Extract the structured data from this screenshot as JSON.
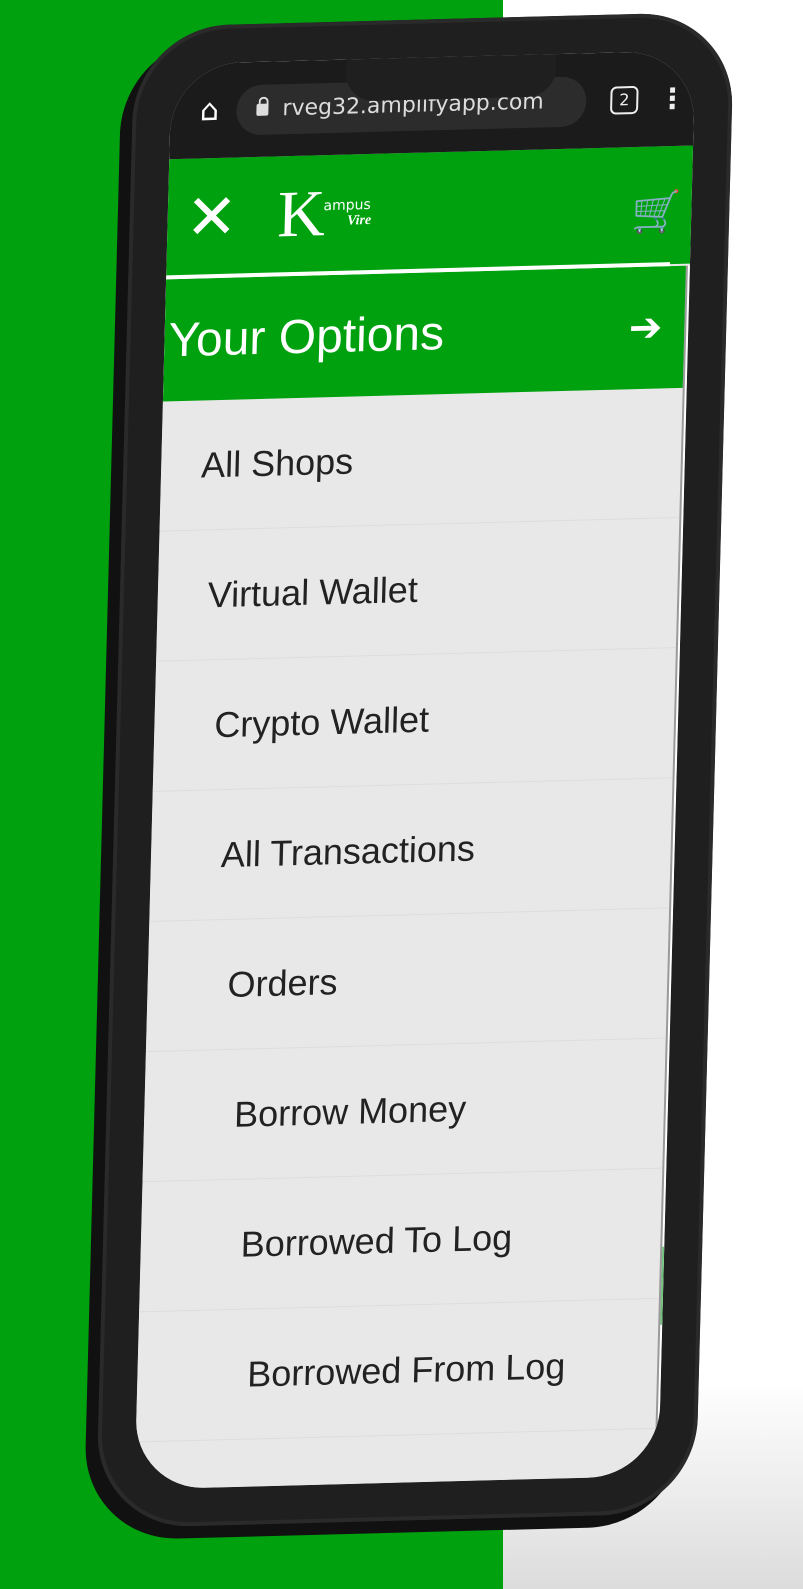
{
  "browser": {
    "url": "rveg32.amplifyapp.com",
    "tab_count": "2",
    "home_icon": "home-icon",
    "menu_icon": "kebab-menu-icon"
  },
  "app": {
    "logo_letter": "K",
    "logo_top": "ampus",
    "logo_bottom": "Vire",
    "brand_color": "#00a10e",
    "cart_icon": "cart-icon",
    "close_icon": "close-icon"
  },
  "drawer": {
    "title": "Your Options",
    "logout_icon": "logout-icon",
    "items": [
      {
        "label": "All Shops"
      },
      {
        "label": "Virtual Wallet"
      },
      {
        "label": "Crypto Wallet"
      },
      {
        "label": "All Transactions"
      },
      {
        "label": "Orders"
      },
      {
        "label": "Borrow Money"
      },
      {
        "label": "Borrowed To Log"
      },
      {
        "label": "Borrowed From Log"
      }
    ]
  }
}
